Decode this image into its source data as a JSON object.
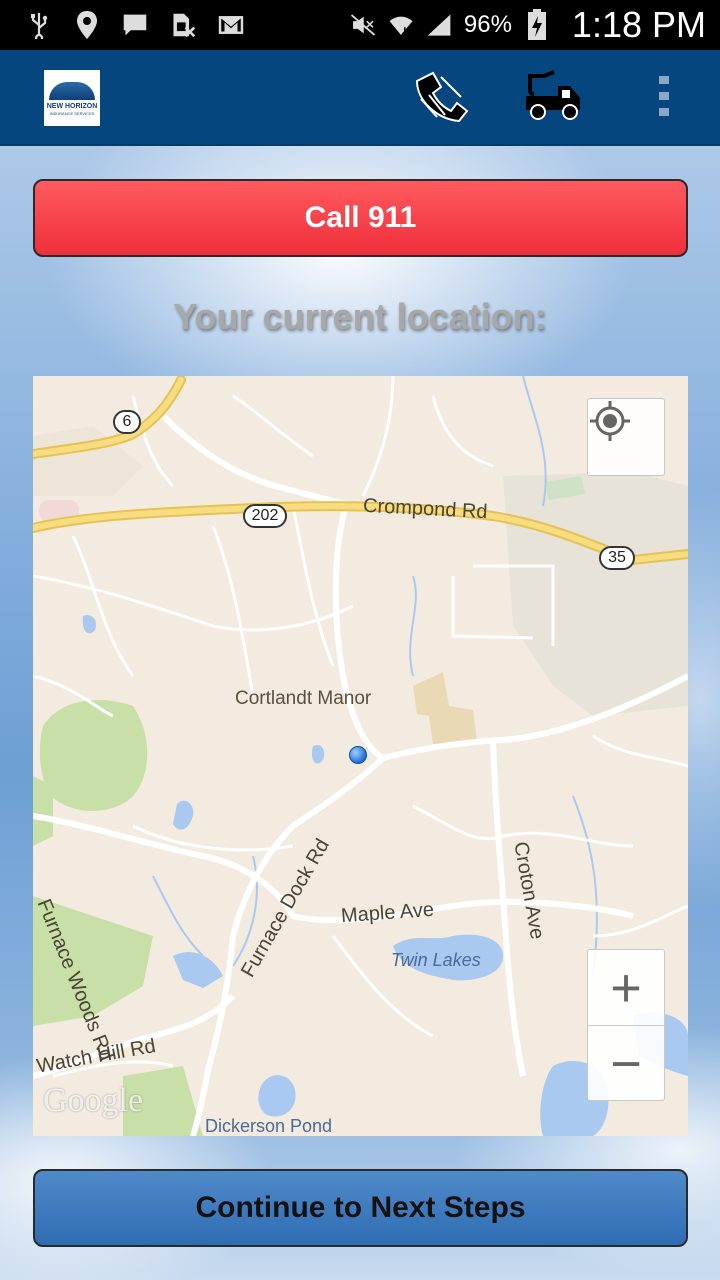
{
  "status_bar": {
    "battery_percent": "96%",
    "time": "1:18 PM"
  },
  "app_bar": {
    "logo": {
      "name": "NEW HORIZON",
      "sub": "INSURANCE SERVICES"
    },
    "actions": [
      {
        "icon": "phone-icon"
      },
      {
        "icon": "tow-truck-icon"
      },
      {
        "icon": "overflow-menu-icon"
      }
    ]
  },
  "call_button": {
    "label": "Call 911"
  },
  "location_label": "Your current location:",
  "map": {
    "labels": {
      "crompond_rd": "Crompond Rd",
      "cortlandt_manor": "Cortlandt Manor",
      "furnace_woods_rd": "Furnace Woods Rd",
      "furnace_dock_rd": "Furnace Dock Rd",
      "maple_ave": "Maple Ave",
      "croton_ave": "Croton Ave",
      "twin_lakes": "Twin Lakes",
      "watch_hill_rd": "Watch Hill Rd",
      "dickerson_pond": "Dickerson Pond"
    },
    "shields": {
      "route_6": "6",
      "route_202": "202",
      "route_35": "35"
    },
    "attribution": "Google",
    "zoom_in": "+",
    "zoom_out": "−"
  },
  "continue_button": {
    "label": "Continue to Next Steps"
  },
  "colors": {
    "app_bar": "#06467f",
    "call_button": "#f0333d",
    "continue_button": "#3a77bd"
  }
}
